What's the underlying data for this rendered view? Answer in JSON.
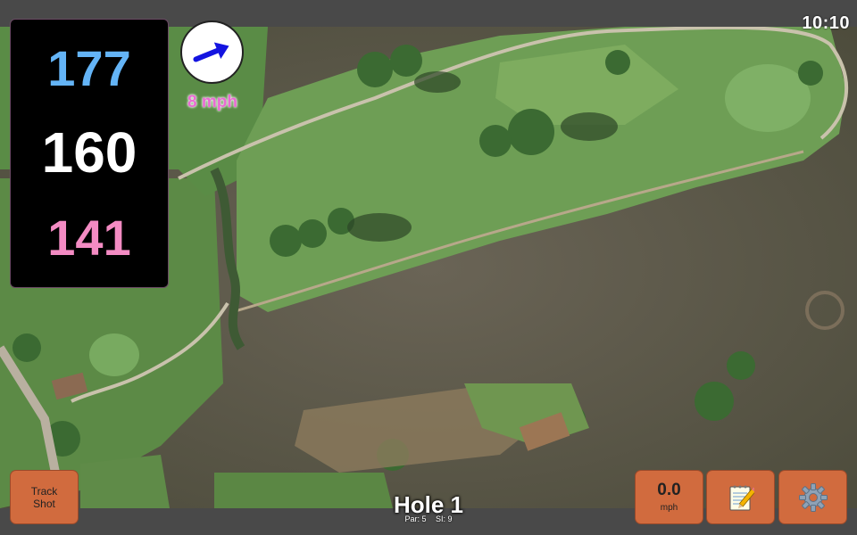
{
  "status": {
    "clock": "10:10"
  },
  "distances": {
    "back": "177",
    "middle": "160",
    "front": "141"
  },
  "wind": {
    "speed_label": "8 mph",
    "icon": "wind-direction-arrow-icon"
  },
  "hole": {
    "title": "Hole 1",
    "par_label": "Par: 5",
    "si_label": "SI: 9"
  },
  "controls": {
    "track_shot_line1": "Track",
    "track_shot_line2": "Shot",
    "speed_value": "0.0",
    "speed_unit": "mph",
    "notes_icon": "notepad-icon",
    "settings_icon": "gear-icon"
  },
  "colors": {
    "back": "#64b4f6",
    "middle": "#ffffff",
    "front": "#f38bc3",
    "wind_text": "#ea6bd3",
    "button": "#d16b3e"
  }
}
